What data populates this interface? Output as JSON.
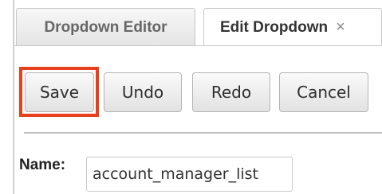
{
  "tabs": [
    {
      "label": "Dropdown Editor",
      "active": false
    },
    {
      "label": "Edit Dropdown",
      "active": true,
      "close_glyph": "×",
      "close_icon": "close-icon"
    }
  ],
  "toolbar": {
    "save_label": "Save",
    "undo_label": "Undo",
    "redo_label": "Redo",
    "cancel_label": "Cancel",
    "highlight_color": "#e8401c"
  },
  "form": {
    "name_label": "Name:",
    "name_value": "account_manager_list"
  }
}
